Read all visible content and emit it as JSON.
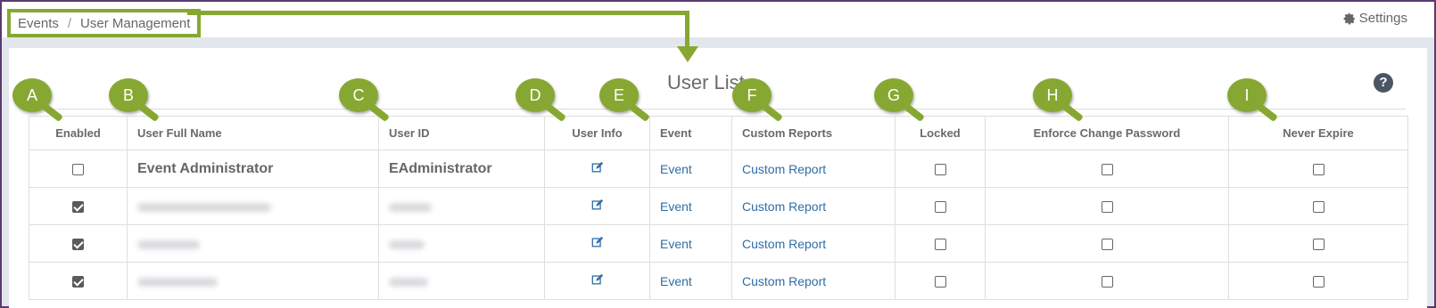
{
  "breadcrumb": {
    "root": "Events",
    "separator": "/",
    "current": "User Management"
  },
  "settings_label": "Settings",
  "page_title": "User List",
  "help_label": "?",
  "columns": [
    "Enabled",
    "User Full Name",
    "User ID",
    "User Info",
    "Event",
    "Custom Reports",
    "Locked",
    "Enforce Change Password",
    "Never Expire"
  ],
  "rows": [
    {
      "enabled": false,
      "full_name": "Event Administrator",
      "user_id": "EAdministrator",
      "event": "Event",
      "custom_report": "Custom Report",
      "locked": false,
      "enforce": false,
      "never_expire": false,
      "redacted": false
    },
    {
      "enabled": true,
      "full_name": "",
      "user_id": "",
      "event": "Event",
      "custom_report": "Custom Report",
      "locked": false,
      "enforce": false,
      "never_expire": false,
      "redacted": true
    },
    {
      "enabled": true,
      "full_name": "",
      "user_id": "",
      "event": "Event",
      "custom_report": "Custom Report",
      "locked": false,
      "enforce": false,
      "never_expire": false,
      "redacted": true
    },
    {
      "enabled": true,
      "full_name": "",
      "user_id": "",
      "event": "Event",
      "custom_report": "Custom Report",
      "locked": false,
      "enforce": false,
      "never_expire": false,
      "redacted": true
    }
  ],
  "markers": [
    "A",
    "B",
    "C",
    "D",
    "E",
    "F",
    "G",
    "H",
    "I"
  ],
  "colors": {
    "annotation": "#86a832",
    "link": "#2f6ea5",
    "frame": "#5a3a6e"
  },
  "icons": {
    "settings": "gear-icon",
    "help": "question-circle-icon",
    "user_info": "edit-icon"
  }
}
